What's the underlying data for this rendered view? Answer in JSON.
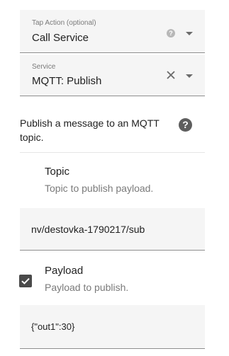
{
  "tap_action": {
    "label": "Tap Action (optional)",
    "value": "Call Service",
    "help_icon": "help-circle-icon",
    "arrow_icon": "chevron-down-icon"
  },
  "service": {
    "label": "Service",
    "value": "MQTT: Publish",
    "clear_icon": "close-icon",
    "arrow_icon": "chevron-down-icon"
  },
  "service_description": "Publish a message to an MQTT topic.",
  "topic": {
    "title": "Topic",
    "description": "Topic to publish payload.",
    "value": "nv/destovka-1790217/sub"
  },
  "payload": {
    "title": "Payload",
    "description": "Payload to publish.",
    "checked": true,
    "value": "{\"out1\":30}"
  },
  "colors": {
    "field_background": "#f5f5f5",
    "checkbox_fill": "#4a4a4a",
    "help_icon_dark": "#5e5e5e"
  }
}
